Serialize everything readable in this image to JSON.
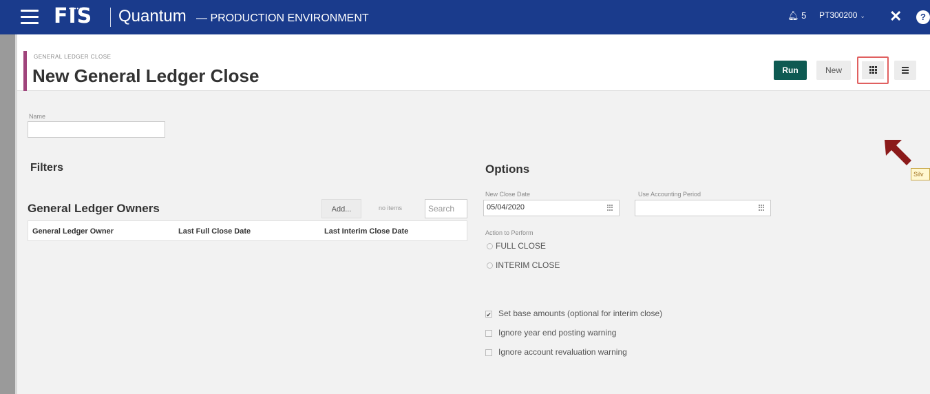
{
  "topbar": {
    "logo": "FIS",
    "product": "Quantum",
    "environment": "— PRODUCTION ENVIRONMENT",
    "notifications_count": "5",
    "user": "PT300200"
  },
  "header": {
    "breadcrumb": "GENERAL LEDGER CLOSE",
    "title": "New General Ledger Close",
    "run_label": "Run",
    "new_label": "New"
  },
  "name_field": {
    "label": "Name",
    "value": ""
  },
  "filters": {
    "title": "Filters"
  },
  "owners": {
    "title": "General Ledger Owners",
    "add_label": "Add...",
    "count_text": "no items",
    "search_placeholder": "Search",
    "columns": [
      "General Ledger Owner",
      "Last Full Close Date",
      "Last Interim Close Date"
    ]
  },
  "options": {
    "title": "Options",
    "new_close_date_label": "New Close Date",
    "new_close_date_value": "05/04/2020",
    "accounting_period_label": "Use Accounting Period",
    "accounting_period_value": "",
    "action_label": "Action to Perform",
    "actions": [
      "FULL CLOSE",
      "INTERIM CLOSE"
    ],
    "checkboxes": [
      {
        "label": "Set base amounts (optional for interim close)",
        "checked": true
      },
      {
        "label": "Ignore year end posting warning",
        "checked": false
      },
      {
        "label": "Ignore account revaluation warning",
        "checked": false
      }
    ]
  },
  "tooltip": {
    "text": "Silv"
  },
  "colors": {
    "topbar": "#1a3b8c",
    "run_button": "#0e5a52",
    "accent": "#a0447c",
    "highlight": "#e06060",
    "arrow": "#8b1a1a"
  }
}
